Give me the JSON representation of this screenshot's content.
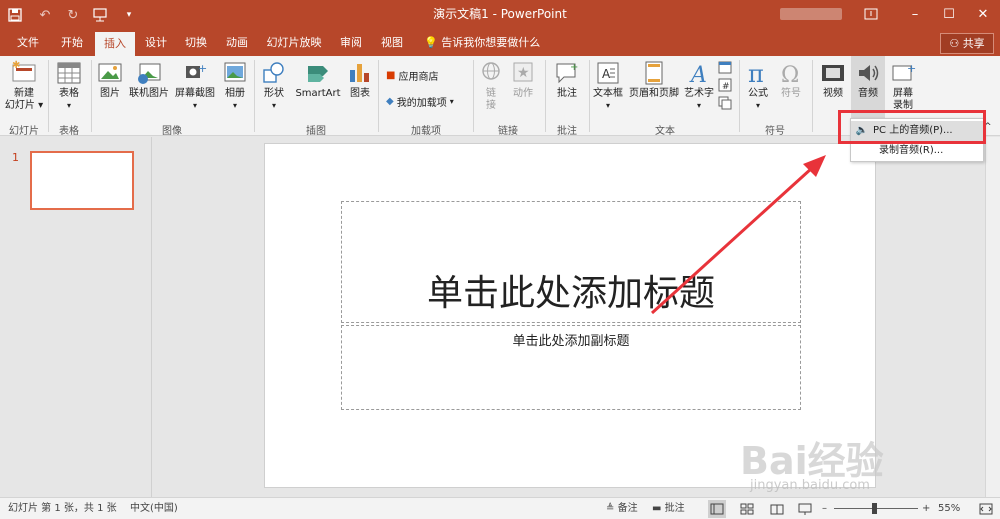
{
  "titlebar": {
    "title": "演示文稿1 - PowerPoint",
    "save_icon": "save-icon",
    "undo_icon": "undo-icon",
    "redo_icon": "redo-icon",
    "present_icon": "present-from-beginning-icon",
    "qat_menu_icon": "qat-customize-icon",
    "minimize": "–",
    "restore": "❐",
    "maximize": "☐",
    "close": "✕"
  },
  "tabs": [
    {
      "label": "文件"
    },
    {
      "label": "开始"
    },
    {
      "label": "插入"
    },
    {
      "label": "设计"
    },
    {
      "label": "切换"
    },
    {
      "label": "动画"
    },
    {
      "label": "幻灯片放映"
    },
    {
      "label": "审阅"
    },
    {
      "label": "视图"
    }
  ],
  "tellme": "告诉我你想要做什么",
  "share": "共享",
  "ribbon": {
    "new_slide": "新建\n幻灯片",
    "table": "表格",
    "picture": "图片",
    "online_picture": "联机图片",
    "screenshot": "屏幕截图",
    "album": "相册",
    "shapes": "形状",
    "smartart": "SmartArt",
    "chart": "图表",
    "store": "应用商店",
    "my_addins": "我的加载项",
    "link": "链\n接",
    "action": "动作",
    "comment": "批注",
    "textbox": "文本框",
    "header_footer": "页眉和页脚",
    "wordart": "艺术字",
    "equation": "公式",
    "symbol": "符号",
    "video": "视频",
    "audio": "音频",
    "screen_recording": "屏幕\n录制",
    "groups": {
      "slides": "幻灯片",
      "tables": "表格",
      "images": "图像",
      "illustrations": "插图",
      "addins": "加载项",
      "links": "链接",
      "comments": "批注",
      "text": "文本",
      "symbols": "符号"
    }
  },
  "audio_menu": {
    "items": [
      {
        "label": "PC 上的音频(P)..."
      },
      {
        "label": "录制音频(R)..."
      }
    ]
  },
  "thumbnails": {
    "slide_number": "1"
  },
  "slide": {
    "title_placeholder": "单击此处添加标题",
    "subtitle_placeholder": "单击此处添加副标题"
  },
  "statusbar": {
    "slide_info": "幻灯片 第 1 张，共 1 张",
    "language": "中文(中国)",
    "notes": "备注",
    "comments": "批注",
    "zoom": "55%",
    "zoom_minus": "–",
    "zoom_plus": "+"
  },
  "watermark": {
    "main": "Bai经验",
    "sub": "jingyan.baidu.com"
  },
  "colors": {
    "accent": "#b7472a",
    "highlight_red": "#e8333a"
  }
}
